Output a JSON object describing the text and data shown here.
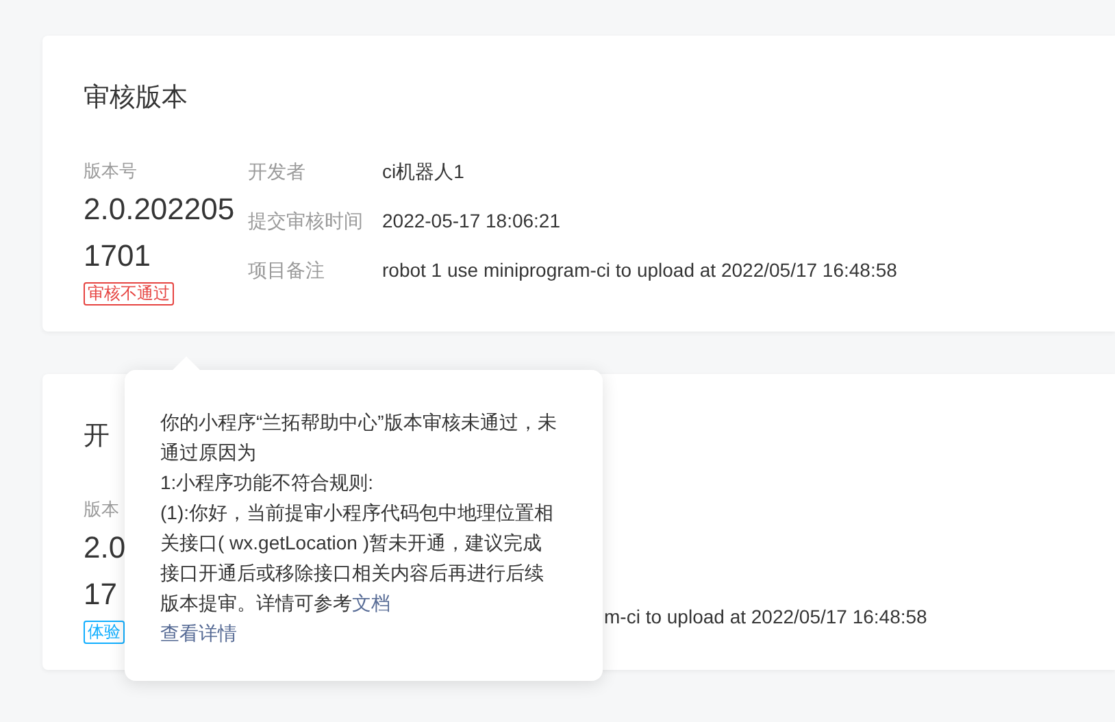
{
  "cards": [
    {
      "title": "审核版本",
      "version_label": "版本号",
      "version": [
        "2.0.202205",
        "1701"
      ],
      "tag": {
        "text": "审核不通过",
        "kind": "rejected"
      },
      "fields": [
        {
          "label": "开发者",
          "value": "ci机器人1"
        },
        {
          "label": "提交审核时间",
          "value": "2022-05-17 18:06:21"
        },
        {
          "label": "项目备注",
          "value": "robot 1 use miniprogram-ci to upload at 2022/05/17 16:48:58"
        }
      ]
    },
    {
      "title": "开",
      "version_label": "版本",
      "version": [
        "2.0",
        "17"
      ],
      "tag": {
        "text": "体验",
        "kind": "trial"
      },
      "fields": [
        {
          "value": "m-ci to upload at 2022/05/17 16:48:58"
        }
      ]
    }
  ],
  "tooltip": {
    "lines": [
      "你的小程序“兰拓帮助中心”版本审核未通过，未通过原因为",
      "1:小程序功能不符合规则:"
    ],
    "reason": "(1):你好，当前提审小程序代码包中地理位置相关接口( wx.getLocation )暂未开通，建议完成接口开通后或移除接口相关内容后再进行后续版本提审。详情可参考",
    "doc_link": "文档",
    "detail_link": "查看详情"
  }
}
